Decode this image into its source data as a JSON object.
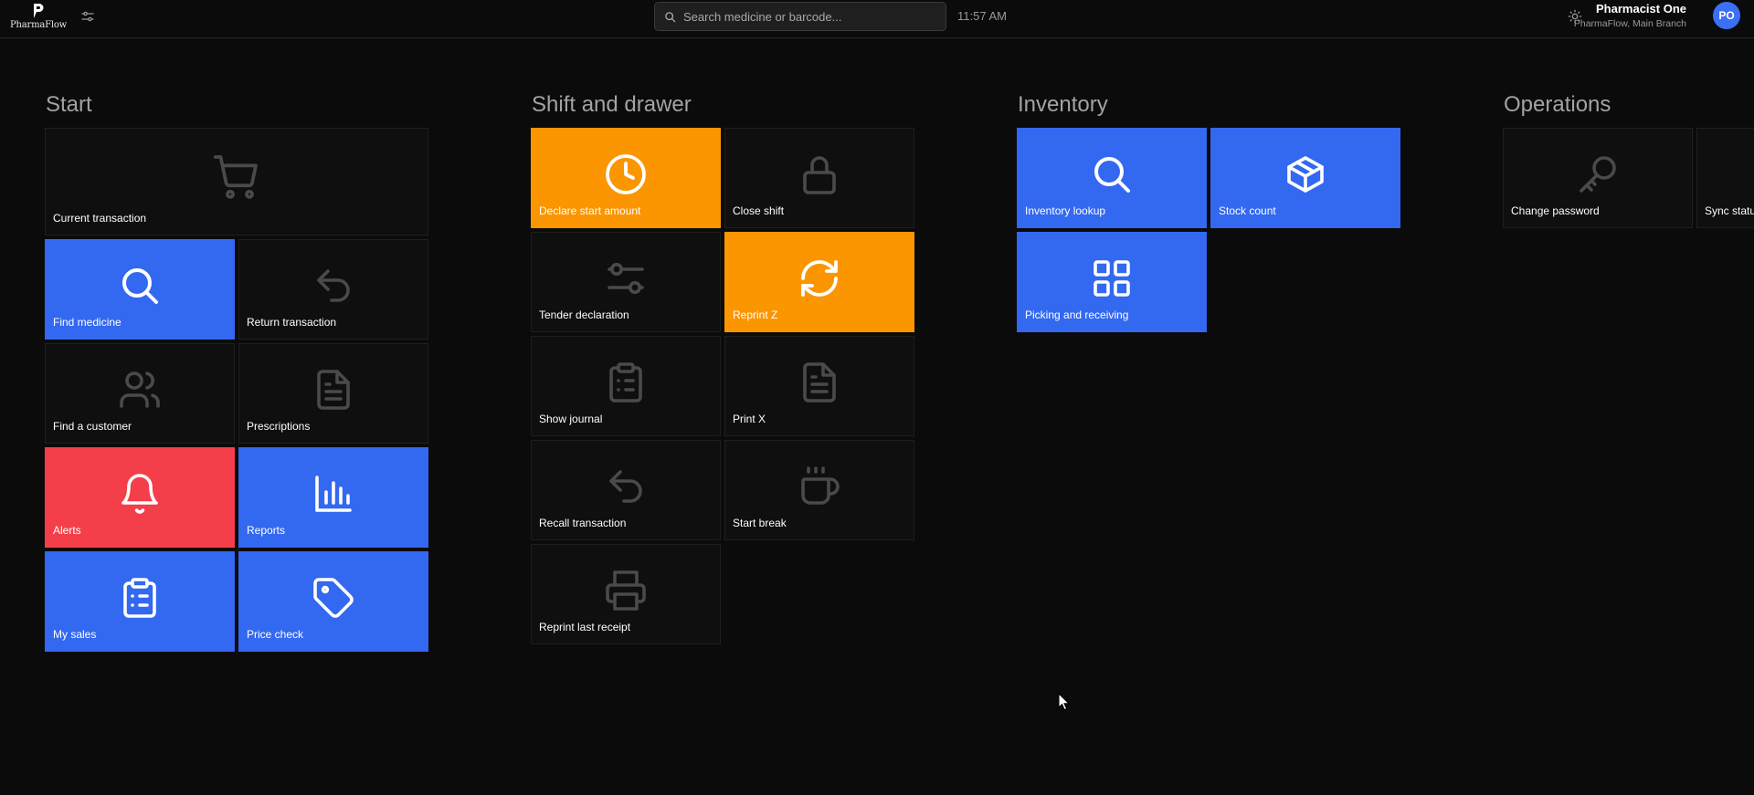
{
  "header": {
    "logo_text": "PharmaFlow",
    "search_placeholder": "Search medicine or barcode...",
    "time": "11:57 AM",
    "user_name": "Pharmacist One",
    "user_branch": "PharmaFlow, Main Branch",
    "avatar_initials": "PO"
  },
  "colors": {
    "background": "#0b0b0b",
    "tile_blue": "#3368f0",
    "tile_orange": "#fb9500",
    "tile_red": "#f43f4a",
    "tile_dark": "#0f0f0f"
  },
  "sections": {
    "start": {
      "title": "Start",
      "tiles": [
        {
          "label": "Current transaction",
          "icon": "cart-icon",
          "color": "dark"
        },
        {
          "label": "Find medicine",
          "icon": "search-icon",
          "color": "blue"
        },
        {
          "label": "Return transaction",
          "icon": "undo-icon",
          "color": "dark"
        },
        {
          "label": "Find a customer",
          "icon": "users-icon",
          "color": "dark"
        },
        {
          "label": "Prescriptions",
          "icon": "document-icon",
          "color": "dark"
        },
        {
          "label": "Alerts",
          "icon": "bell-icon",
          "color": "red"
        },
        {
          "label": "Reports",
          "icon": "bar-chart-icon",
          "color": "blue"
        },
        {
          "label": "My sales",
          "icon": "clipboard-icon",
          "color": "blue"
        },
        {
          "label": "Price check",
          "icon": "tag-icon",
          "color": "blue"
        }
      ]
    },
    "shift": {
      "title": "Shift and drawer",
      "tiles": [
        {
          "label": "Declare start amount",
          "icon": "clock-icon",
          "color": "orange"
        },
        {
          "label": "Close shift",
          "icon": "lock-icon",
          "color": "dark"
        },
        {
          "label": "Tender declaration",
          "icon": "sliders-icon",
          "color": "dark"
        },
        {
          "label": "Reprint Z",
          "icon": "refresh-icon",
          "color": "orange"
        },
        {
          "label": "Show journal",
          "icon": "clipboard-icon",
          "color": "dark"
        },
        {
          "label": "Print X",
          "icon": "document-icon",
          "color": "dark"
        },
        {
          "label": "Recall transaction",
          "icon": "undo-icon",
          "color": "dark"
        },
        {
          "label": "Start break",
          "icon": "coffee-icon",
          "color": "dark"
        },
        {
          "label": "Reprint last receipt",
          "icon": "printer-icon",
          "color": "dark"
        }
      ]
    },
    "inventory": {
      "title": "Inventory",
      "tiles": [
        {
          "label": "Inventory lookup",
          "icon": "search-icon",
          "color": "blue"
        },
        {
          "label": "Stock count",
          "icon": "box-icon",
          "color": "blue"
        },
        {
          "label": "Picking and receiving",
          "icon": "grid-icon",
          "color": "blue"
        }
      ]
    },
    "operations": {
      "title": "Operations",
      "tiles": [
        {
          "label": "Change password",
          "icon": "key-icon",
          "color": "dark"
        },
        {
          "label": "Sync status",
          "icon": "sync-icon",
          "color": "dark"
        }
      ]
    }
  }
}
